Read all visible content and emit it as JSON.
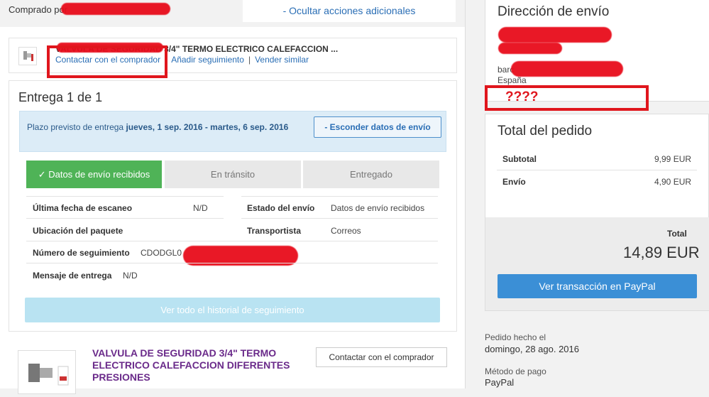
{
  "header": {
    "bought_by": "Comprado por",
    "hide_actions": "- Ocultar acciones adicionales"
  },
  "item": {
    "title": "VALVULA DE SEGURIDAD 3/4\" TERMO ELECTRICO CALEFACCION ...",
    "links": [
      "Contactar con el comprador",
      "Añadir seguimiento",
      "Vender similar"
    ]
  },
  "delivery": {
    "title": "Entrega 1 de 1",
    "eta_prefix": "Plazo previsto de entrega",
    "eta_dates": "jueves, 1 sep. 2016 - martes, 6 sep. 2016",
    "hide_button": "- Esconder datos de envío",
    "steps": [
      "✓ Datos de envío recibidos",
      "En tránsito",
      "Entregado"
    ],
    "rows": [
      {
        "label": "Última fecha de escaneo",
        "value": "N/D"
      },
      {
        "label": "Estado del envío",
        "value": "Datos de envío recibidos"
      },
      {
        "label": "Ubicación del paquete",
        "value": ""
      },
      {
        "label": "Transportista",
        "value": "Correos"
      },
      {
        "label": "Número de seguimiento",
        "value": "CDODGL0"
      },
      {
        "label": "Mensaje de entrega",
        "value": "N/D"
      }
    ],
    "history_button": "Ver todo el historial de seguimiento"
  },
  "item2": {
    "title": "VALVULA DE SEGURIDAD 3/4\" TERMO ELECTRICO CALEFACCION DIFERENTES PRESIONES",
    "contact_button": "Contactar con el comprador"
  },
  "shipping": {
    "title": "Dirección de envío",
    "lines": [
      "barc",
      "España"
    ],
    "annotation": "????"
  },
  "order_total": {
    "title": "Total del pedido",
    "subtotal_label": "Subtotal",
    "subtotal_value": "9,99 EUR",
    "shipping_label": "Envío",
    "shipping_value": "4,90 EUR",
    "total_label": "Total",
    "total_value": "14,89 EUR",
    "paypal_button": "Ver transacción en PayPal"
  },
  "meta": {
    "order_placed_label": "Pedido hecho el",
    "order_placed_value": "domingo, 28 ago. 2016",
    "payment_label": "Método de pago",
    "payment_value": "PayPal"
  },
  "colors": {
    "link": "#2a6eb5",
    "step_active": "#4fb357",
    "paypal_button": "#3b8fd6",
    "annotation_red": "#e0161d",
    "item2_title": "#6a2a8a"
  }
}
